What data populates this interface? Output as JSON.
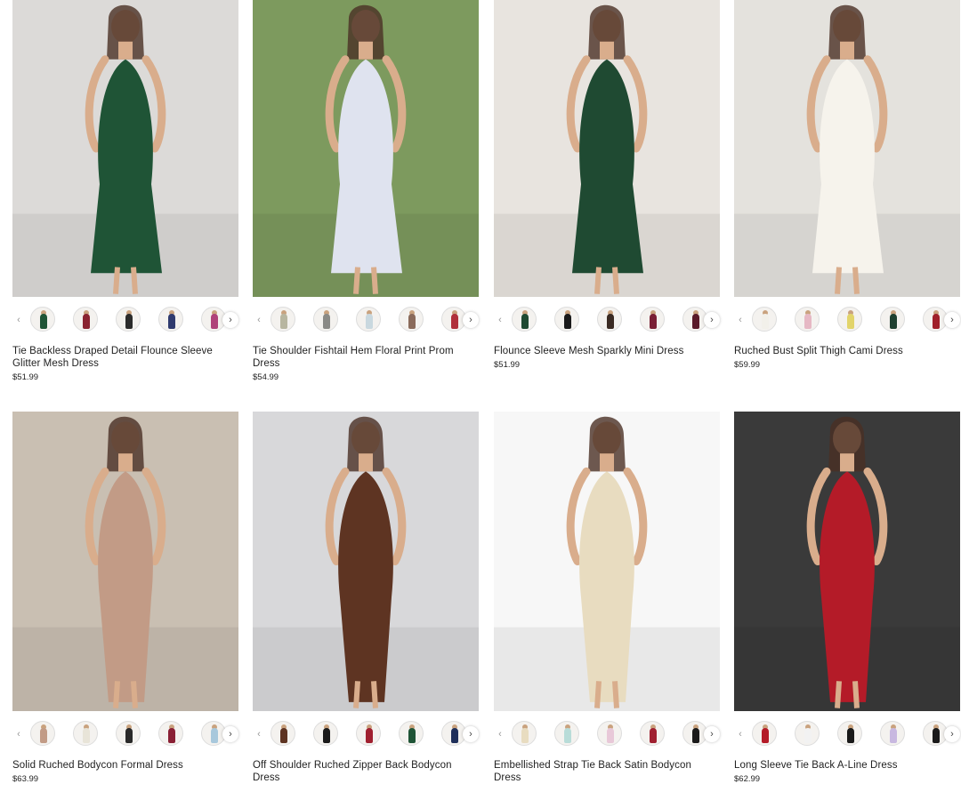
{
  "products": [
    {
      "title": "Tie Backless Draped Detail Flounce Sleeve Glitter Mesh Dress",
      "price": "$51.99",
      "bg": "#dcdad8",
      "dress": "#1f5436",
      "swatches": [
        "#1f5436",
        "#8a2330",
        "#2b2b2b",
        "#2f3a6e",
        "#b0427a"
      ]
    },
    {
      "title": "Tie Shoulder Fishtail Hem Floral Print Prom Dress",
      "price": "$54.99",
      "bg": "#7d9a5e",
      "dress": "#dfe3ef",
      "swatches": [
        "#b8b6a0",
        "#8a8a86",
        "#c9d8df",
        "#8a6a5a",
        "#b0303a"
      ]
    },
    {
      "title": "Flounce Sleeve Mesh Sparkly Mini Dress",
      "price": "$51.99",
      "bg": "#e8e4df",
      "dress": "#1f4a32",
      "swatches": [
        "#1f4a32",
        "#1a1a1a",
        "#3a2a22",
        "#7a1f35",
        "#5a1a2a"
      ]
    },
    {
      "title": "Ruched Bust Split Thigh Cami Dress",
      "price": "$59.99",
      "bg": "#e4e2dd",
      "dress": "#f6f3ec",
      "swatches": [
        "#f2f0ea",
        "#e6b8c4",
        "#e2d46a",
        "#1f4030",
        "#a0202a"
      ]
    },
    {
      "title": "Solid Ruched Bodycon Formal Dress",
      "price": "$63.99",
      "bg": "#c9bfb2",
      "dress": "#c29b86",
      "swatches": [
        "#c29b86",
        "#e8e4d8",
        "#2a2a2a",
        "#8a2035",
        "#a8c8dc"
      ]
    },
    {
      "title": "Off Shoulder Ruched Zipper Back Bodycon Dress",
      "price": "",
      "bg": "#d8d8da",
      "dress": "#5e3422",
      "swatches": [
        "#5e3422",
        "#1a1a1a",
        "#a02030",
        "#1f5436",
        "#1f2f5a"
      ]
    },
    {
      "title": "Embellished Strap Tie Back Satin Bodycon Dress",
      "price": "",
      "bg": "#f7f7f7",
      "dress": "#e8dcc0",
      "swatches": [
        "#e8dcc0",
        "#b8dcd8",
        "#e8c8d8",
        "#a02030",
        "#1a1a1a"
      ]
    },
    {
      "title": "Long Sleeve Tie Back A-Line Dress",
      "price": "$62.99",
      "bg": "#3a3a3a",
      "dress": "#b41b28",
      "swatches": [
        "#b41b28",
        "#f2f2f2",
        "#1a1a1a",
        "#c8b8e0",
        "#1a1a1a"
      ]
    }
  ],
  "controls": {
    "prev": "‹",
    "next": "›"
  }
}
